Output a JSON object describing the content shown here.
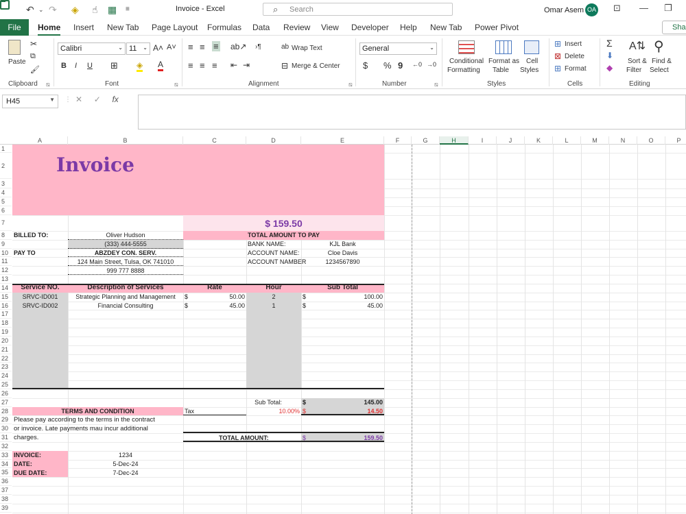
{
  "window": {
    "title": "Invoice  -  Excel",
    "search_placeholder": "Search",
    "user": "Omar Asem",
    "initials": "OA"
  },
  "menu": {
    "file": "File",
    "tabs": [
      "Home",
      "Insert",
      "New Tab",
      "Page Layout",
      "Formulas",
      "Data",
      "Review",
      "View",
      "Developer",
      "Help",
      "New Tab",
      "Power Pivot"
    ],
    "share": "Sha"
  },
  "ribbon": {
    "clipboard": {
      "label": "Clipboard",
      "paste": "Paste"
    },
    "font": {
      "label": "Font",
      "name": "Calibri",
      "size": "11",
      "bold": "B",
      "italic": "I",
      "underline": "U"
    },
    "alignment": {
      "label": "Alignment",
      "wrap": "Wrap Text",
      "merge": "Merge & Center"
    },
    "number": {
      "label": "Number",
      "format": "General",
      "currency": "$",
      "percent": "%",
      "comma": "9"
    },
    "styles": {
      "label": "Styles",
      "cond1": "Conditional",
      "cond2": "Formatting",
      "fmt1": "Format as",
      "fmt2": "Table",
      "cell1": "Cell",
      "cell2": "Styles"
    },
    "cells": {
      "label": "Cells",
      "insert": "Insert",
      "delete": "Delete",
      "format": "Format"
    },
    "editing": {
      "label": "Editing",
      "sort1": "Sort &",
      "sort2": "Filter",
      "find1": "Find &",
      "find2": "Select"
    }
  },
  "formula": {
    "namebox": "H45",
    "value": ""
  },
  "columns": [
    "A",
    "B",
    "C",
    "D",
    "E",
    "F",
    "G",
    "H",
    "I",
    "J",
    "K",
    "L",
    "M",
    "N",
    "O",
    "P"
  ],
  "rows": [
    "1",
    "2",
    "3",
    "4",
    "5",
    "6",
    "7",
    "8",
    "9",
    "10",
    "11",
    "12",
    "13",
    "14",
    "15",
    "16",
    "17",
    "18",
    "19",
    "20",
    "21",
    "22",
    "23",
    "24",
    "25",
    "26",
    "27",
    "28",
    "29",
    "30",
    "31",
    "32",
    "33",
    "34",
    "35",
    "36",
    "37",
    "38",
    "39"
  ],
  "invoice": {
    "title": "Invoice",
    "amount": "$ 159.50",
    "total_label": "TOTAL AMOUNT TO PAY",
    "billed_to": "BILLED TO:",
    "client_name": "Oliver Hudson",
    "client_phone": "(333) 444-5555",
    "pay_to": "PAY TO",
    "payee_name": "ABZDEY CON. SERV.",
    "payee_address": "124 Main Street, Tulsa, OK 741010",
    "payee_phone": "999 777 8888",
    "bank_name_label": "BANK NAME:",
    "bank_name": "KJL Bank",
    "account_name_label": "ACCOUNT NAME:",
    "account_name": "Cloe Davis",
    "account_number_label": "ACCOUNT NAMBER",
    "account_number": "1234567890",
    "headers": {
      "service": "Service NO.",
      "description": "Description of Services",
      "rate": "Rate",
      "hour": "Hour",
      "subtotal": "Sub Total"
    },
    "items": [
      {
        "service": "SRVC-ID001",
        "description": "Strategic Planning and Management",
        "rate_cur": "$",
        "rate": "50.00",
        "hour": "2",
        "sub_cur": "$",
        "subtotal": "100.00"
      },
      {
        "service": "SRVC-ID002",
        "description": "Financial Consulting",
        "rate_cur": "$",
        "rate": "45.00",
        "hour": "1",
        "sub_cur": "$",
        "subtotal": "45.00"
      }
    ],
    "subtotal_label": "Sub Total:",
    "subtotal_cur": "$",
    "subtotal_value": "145.00",
    "tax_label": "Tax",
    "tax_rate": "10.00%",
    "tax_cur": "$",
    "tax_value": "14.50",
    "terms_title": "TERMS AND CONDITION",
    "terms_lines": [
      "Please pay according to the terms in the contract",
      "or invoice. Late payments mau incur additional",
      "charges."
    ],
    "grand_label": "TOTAL AMOUNT:",
    "grand_cur": "$",
    "grand_value": "159.50",
    "invoice_label": "INVOICE:",
    "invoice_no": "1234",
    "date_label": "DATE:",
    "date": "5-Dec-24",
    "due_label": "DUE DATE:",
    "due_date": "7-Dec-24"
  },
  "colors": {
    "excel_green": "#217346",
    "pink": "#ffb6c8",
    "light_pink": "#fde4ec",
    "purple": "#7b3aa6",
    "gray": "#d6d6d6",
    "red": "#e03030"
  }
}
